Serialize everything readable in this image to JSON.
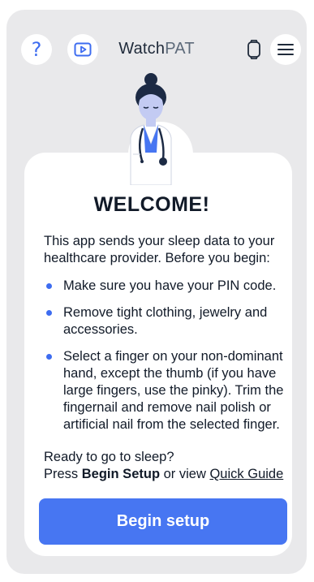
{
  "header": {
    "brand_part1": "Watch",
    "brand_part2": "PAT",
    "icons": {
      "help": "question-mark-icon",
      "video": "play-video-icon",
      "watch": "smartwatch-icon",
      "menu": "hamburger-menu-icon"
    },
    "help_glyph": "?"
  },
  "card": {
    "title": "WELCOME!",
    "intro": "This app sends your sleep data to your healthcare provider. Before you begin:",
    "bullets": [
      "Make sure you have your PIN code.",
      "Remove tight clothing, jewelry and accessories.",
      "Select a finger on your non-dominant hand, except the thumb (if you have large fingers, use the pinky). Trim the fingernail and remove nail polish or artificial nail from the selected finger."
    ],
    "ready_line": "Ready to go to sleep?",
    "press_prefix": "Press ",
    "press_bold": "Begin Setup",
    "press_middle": " or view ",
    "press_link": "Quick Guide",
    "begin_button": "Begin setup"
  },
  "colors": {
    "accent": "#4776f2",
    "background": "#e9e9eb",
    "text": "#111a28"
  }
}
